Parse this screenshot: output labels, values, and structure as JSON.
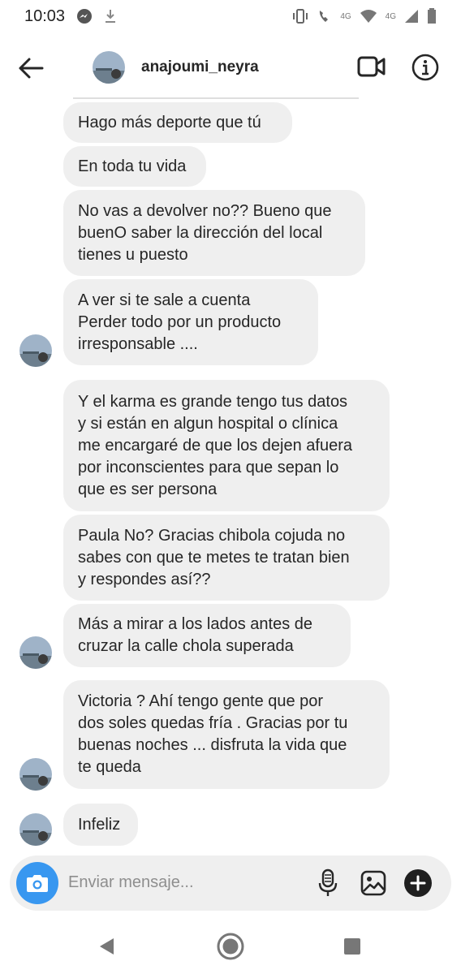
{
  "status_bar": {
    "time": "10:03",
    "network_label_1": "4G",
    "network_label_2": "4G"
  },
  "header": {
    "username": "anajoumi_neyra"
  },
  "messages": [
    {
      "lines": [
        "Hago más deporte que tú"
      ]
    },
    {
      "lines": [
        "En toda tu vida"
      ]
    },
    {
      "lines": [
        "No vas a devolver no?? Bueno que",
        "buenO saber la dirección del local",
        "tienes u puesto"
      ]
    },
    {
      "lines": [
        "A ver si te sale a cuenta",
        "Perder todo por un producto",
        "irresponsable ...."
      ]
    },
    {
      "lines": [
        "Y el karma es grande tengo tus datos",
        "y si están en algun hospital o clínica",
        "me encargaré de que los dejen afuera",
        "por inconscientes para que sepan lo",
        "que es ser persona"
      ]
    },
    {
      "lines": [
        "Paula No? Gracias chibola cojuda no",
        "sabes con que te metes te tratan bien",
        "y respondes así??"
      ]
    },
    {
      "lines": [
        "Más a mirar a los lados antes de",
        "cruzar la calle chola superada"
      ]
    },
    {
      "lines": [
        "Victoria ? Ahí tengo gente que por",
        "dos soles quedas fría . Gracias por tu",
        "buenas noches ...  disfruta la vida que",
        "te queda"
      ]
    },
    {
      "lines": [
        "Infeliz"
      ]
    }
  ],
  "composer": {
    "placeholder": "Enviar mensaje..."
  },
  "icons": {
    "back": "arrow-left-icon",
    "video": "video-call-icon",
    "info": "info-icon",
    "camera": "camera-icon",
    "mic": "microphone-icon",
    "gallery": "gallery-icon",
    "plus": "plus-icon",
    "nav_back": "triangle-back-icon",
    "nav_home": "circle-home-icon",
    "nav_recent": "square-recents-icon"
  },
  "colors": {
    "accent": "#3897f0",
    "bubble": "#efefef",
    "text": "#262626",
    "placeholder": "#8e8e8e"
  }
}
